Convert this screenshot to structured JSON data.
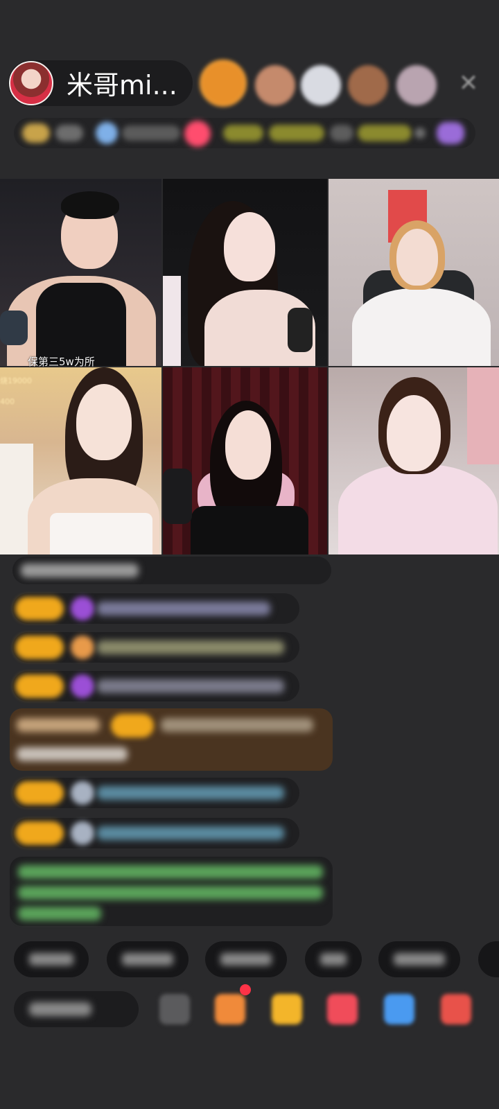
{
  "host": {
    "name": "米哥mi..."
  },
  "video": {
    "caption": "保第三5w为所",
    "side_counter_top": "烧19000",
    "side_counter_bottom": "400"
  },
  "colors": {
    "background": "#2a2a2c",
    "badge_orange": "#f0a81c",
    "gem_purple": "#9b4fd6",
    "chat_bubble": "#1f1f21",
    "highlight_bubble": "#4a3420",
    "green_system": "#5aa35a"
  },
  "icons": {
    "close": "close-icon",
    "gift": "gift-icon",
    "share": "share-icon"
  }
}
